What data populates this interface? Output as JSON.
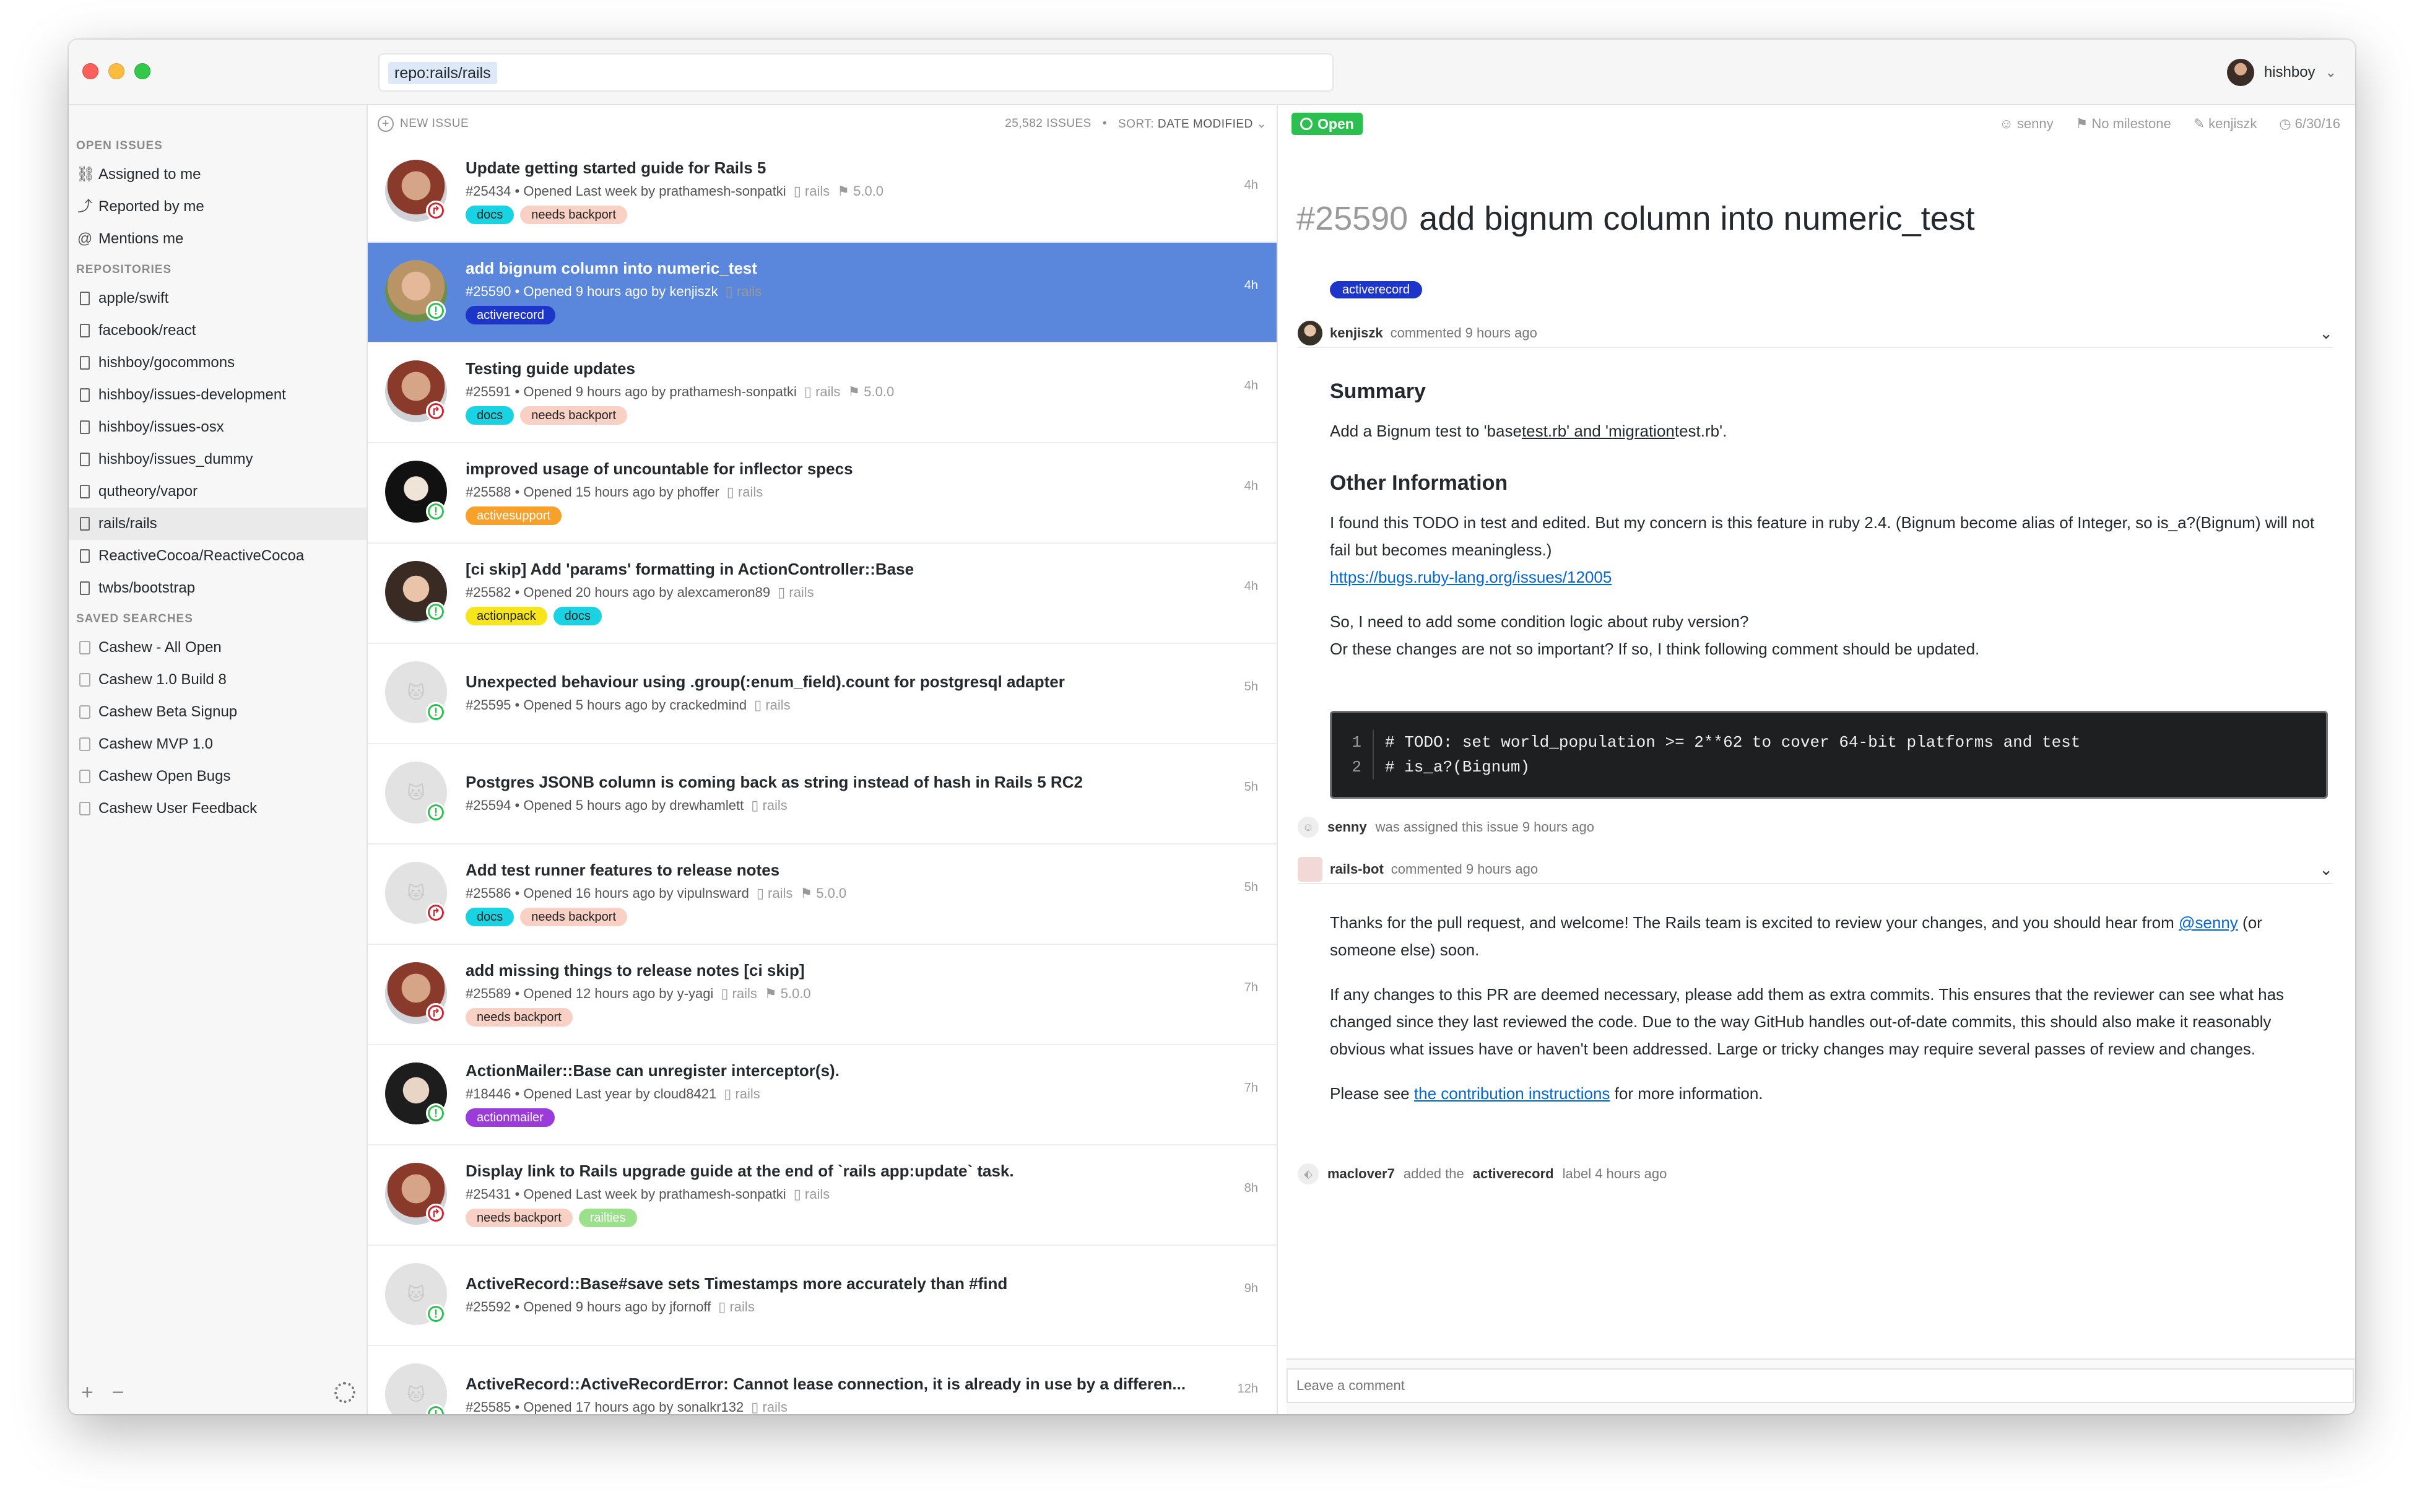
{
  "search": {
    "token": "repo:rails/rails"
  },
  "user": {
    "name": "hishboy"
  },
  "sidebar": {
    "open_issues_title": "OPEN ISSUES",
    "open_issues": [
      {
        "label": "Assigned to me",
        "icon": "assigned-icon",
        "glyph": "⛓"
      },
      {
        "label": "Reported by me",
        "icon": "reported-icon",
        "glyph": "⤴"
      },
      {
        "label": "Mentions me",
        "icon": "at-icon",
        "glyph": "@"
      }
    ],
    "repositories_title": "REPOSITORIES",
    "repositories": [
      "apple/swift",
      "facebook/react",
      "hishboy/gocommons",
      "hishboy/issues-development",
      "hishboy/issues-osx",
      "hishboy/issues_dummy",
      "qutheory/vapor",
      "rails/rails",
      "ReactiveCocoa/ReactiveCocoa",
      "twbs/bootstrap"
    ],
    "active_repository": "rails/rails",
    "saved_title": "SAVED SEARCHES",
    "saved": [
      "Cashew - All Open",
      "Cashew 1.0 Build 8",
      "Cashew Beta Signup",
      "Cashew MVP 1.0",
      "Cashew Open Bugs",
      "Cashew User Feedback"
    ],
    "footer_add": "+",
    "footer_remove": "−"
  },
  "list": {
    "new_issue": "NEW ISSUE",
    "count": "25,582 ISSUES",
    "sort_label": "SORT:",
    "sort_value": "DATE MODIFIED",
    "issues": [
      {
        "title": "Update getting started guide for Rails 5",
        "meta": "#25434 • Opened Last week by prathamesh-sonpatki",
        "repo": "rails",
        "milestone": "5.0.0",
        "labels": [
          {
            "name": "docs",
            "color": "#19d3e3"
          },
          {
            "name": "needs backport",
            "color": "#f9d0c4"
          }
        ],
        "age": "4h",
        "status": "pr",
        "avatar": "av-person-a"
      },
      {
        "title": "add bignum column into numeric_test",
        "meta": "#25590 • Opened 9 hours ago by kenjiszk",
        "repo": "rails",
        "milestone": "",
        "labels": [
          {
            "name": "activerecord",
            "color": "#1e36c7",
            "text": "#ffffff"
          }
        ],
        "age": "4h",
        "status": "open",
        "avatar": "av-person-b",
        "selected": true
      },
      {
        "title": "Testing guide updates",
        "meta": "#25591 • Opened 9 hours ago by prathamesh-sonpatki",
        "repo": "rails",
        "milestone": "5.0.0",
        "labels": [
          {
            "name": "docs",
            "color": "#19d3e3"
          },
          {
            "name": "needs backport",
            "color": "#f9d0c4"
          }
        ],
        "age": "4h",
        "status": "pr",
        "avatar": "av-person-a"
      },
      {
        "title": "improved usage of uncountable for inflector specs",
        "meta": "#25588 • Opened 15 hours ago by phoffer",
        "repo": "rails",
        "milestone": "",
        "labels": [
          {
            "name": "activesupport",
            "color": "#f7a12b",
            "text": "#ffffff"
          }
        ],
        "age": "4h",
        "status": "open",
        "avatar": "av-person-e"
      },
      {
        "title": "[ci skip] Add 'params' formatting in ActionController::Base",
        "meta": "#25582 • Opened 20 hours ago by alexcameron89",
        "repo": "rails",
        "milestone": "",
        "labels": [
          {
            "name": "actionpack",
            "color": "#f5e51a"
          },
          {
            "name": "docs",
            "color": "#19d3e3"
          }
        ],
        "age": "4h",
        "status": "open",
        "avatar": "av-person-d"
      },
      {
        "title": "Unexpected behaviour using .group(:enum_field).count for postgresql adapter",
        "meta": "#25595 • Opened 5 hours ago by crackedmind",
        "repo": "rails",
        "milestone": "",
        "labels": [],
        "age": "5h",
        "status": "open",
        "avatar": "av-default"
      },
      {
        "title": "Postgres JSONB column is coming back as string instead of hash in Rails 5 RC2",
        "meta": "#25594 • Opened 5 hours ago by drewhamlett",
        "repo": "rails",
        "milestone": "",
        "labels": [],
        "age": "5h",
        "status": "open",
        "avatar": "av-default"
      },
      {
        "title": "Add test runner features to release notes",
        "meta": "#25586 • Opened 16 hours ago by vipulnsward",
        "repo": "rails",
        "milestone": "5.0.0",
        "labels": [
          {
            "name": "docs",
            "color": "#19d3e3"
          },
          {
            "name": "needs backport",
            "color": "#f9d0c4"
          }
        ],
        "age": "5h",
        "status": "pr",
        "avatar": "av-default"
      },
      {
        "title": "add missing things to release notes [ci skip]",
        "meta": "#25589 • Opened 12 hours ago by y-yagi",
        "repo": "rails",
        "milestone": "5.0.0",
        "labels": [
          {
            "name": "needs backport",
            "color": "#f9d0c4"
          }
        ],
        "age": "7h",
        "status": "pr",
        "avatar": "av-person-a"
      },
      {
        "title": "ActionMailer::Base can unregister interceptor(s).",
        "meta": "#18446 • Opened Last year by cloud8421",
        "repo": "rails",
        "milestone": "",
        "labels": [
          {
            "name": "actionmailer",
            "color": "#9b3bd9",
            "text": "#ffffff"
          }
        ],
        "age": "7h",
        "status": "open",
        "avatar": "av-person-c"
      },
      {
        "title": "Display link to Rails upgrade guide at the end of `rails app:update` task.",
        "meta": "#25431 • Opened Last week by prathamesh-sonpatki",
        "repo": "rails",
        "milestone": "",
        "labels": [
          {
            "name": "needs backport",
            "color": "#f9d0c4"
          },
          {
            "name": "railties",
            "color": "#9be08b",
            "text": "#ffffff"
          }
        ],
        "age": "8h",
        "status": "pr",
        "avatar": "av-person-a"
      },
      {
        "title": "ActiveRecord::Base#save sets Timestamps more accurately than #find",
        "meta": "#25592 • Opened 9 hours ago by jfornoff",
        "repo": "rails",
        "milestone": "",
        "labels": [],
        "age": "9h",
        "status": "open",
        "avatar": "av-default"
      },
      {
        "title": "ActiveRecord::ActiveRecordError: Cannot lease connection, it is already in use by a differen...",
        "meta": "#25585 • Opened 17 hours ago by sonalkr132",
        "repo": "rails",
        "milestone": "",
        "labels": [],
        "age": "12h",
        "status": "open",
        "avatar": "av-default"
      }
    ]
  },
  "detail": {
    "state": "Open",
    "assignee": "senny",
    "milestone": "No milestone",
    "author": "kenjiszk",
    "date": "6/30/16",
    "number": "#25590",
    "title": "add bignum column into numeric_test",
    "label": "activerecord",
    "comment1": {
      "author": "kenjiszk",
      "action": "commented 9 hours ago",
      "summary_heading": "Summary",
      "summary_a": "Add a Bignum test to 'base",
      "summary_b": "test.rb' and 'migration",
      "summary_c": "test.rb'.",
      "other_heading": "Other Information",
      "para1": "I found this TODO in test and edited. But my concern is this feature in ruby 2.4. (Bignum become alias of Integer, so is_a?(Bignum) will not fail but becomes meaningless.)",
      "link1": "https://bugs.ruby-lang.org/issues/12005",
      "para2a": "So, I need to add some condition logic about ruby version?",
      "para2b": "Or these changes are not so important? If so, I think following comment should be updated.",
      "code": [
        {
          "n": "1",
          "text": "# TODO: set world_population >= 2**62 to cover 64-bit platforms and test"
        },
        {
          "n": "2",
          "text": "# is_a?(Bignum)"
        }
      ]
    },
    "event1": {
      "who": "senny",
      "text": "was assigned this issue 9 hours ago"
    },
    "comment2": {
      "author": "rails-bot",
      "action": "commented 9 hours ago",
      "p1a": "Thanks for the pull request, and welcome! The Rails team is excited to review your changes, and you should hear from",
      "mention": "@senny",
      "p1b": "(or someone else) soon.",
      "p2": "If any changes to this PR are deemed necessary, please add them as extra commits. This ensures that the reviewer can see what has changed since they last reviewed the code. Due to the way GitHub handles out-of-date commits, this should also make it reasonably obvious what issues have or haven't been addressed. Large or tricky changes may require several passes of review and changes.",
      "p3a": "Please see",
      "p3link": "the contribution instructions",
      "p3b": "for more information."
    },
    "event2": {
      "who": "maclover7",
      "text_a": "added the",
      "label": "activerecord",
      "text_b": "label 4 hours ago"
    },
    "comment_placeholder": "Leave a comment"
  }
}
